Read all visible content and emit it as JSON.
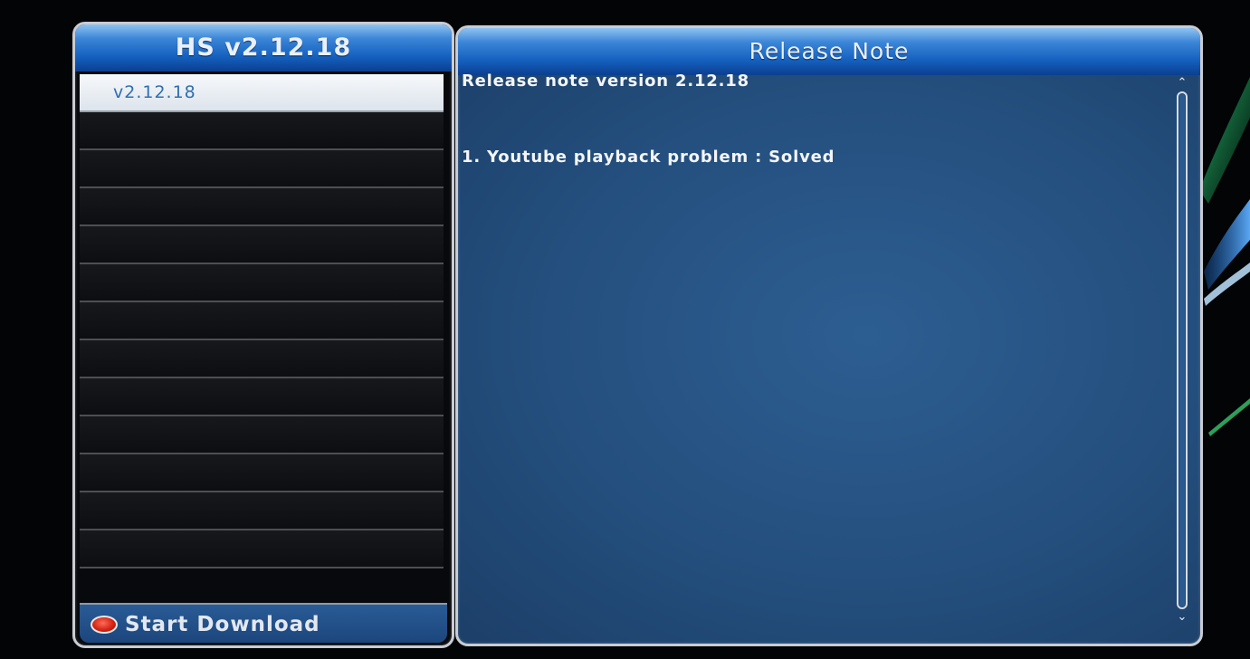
{
  "left_panel": {
    "title": "HS v2.12.18",
    "versions": [
      {
        "label": "v2.12.18",
        "selected": true
      },
      {
        "label": "",
        "selected": false
      },
      {
        "label": "",
        "selected": false
      },
      {
        "label": "",
        "selected": false
      },
      {
        "label": "",
        "selected": false
      },
      {
        "label": "",
        "selected": false
      },
      {
        "label": "",
        "selected": false
      },
      {
        "label": "",
        "selected": false
      },
      {
        "label": "",
        "selected": false
      },
      {
        "label": "",
        "selected": false
      },
      {
        "label": "",
        "selected": false
      },
      {
        "label": "",
        "selected": false
      },
      {
        "label": "",
        "selected": false
      }
    ],
    "footer": {
      "label": "Start Download",
      "icon": "red-button-icon"
    }
  },
  "right_panel": {
    "title": "Release Note",
    "lines": [
      "Release note version 2.12.18",
      "1. Youtube playback problem : Solved"
    ]
  },
  "colors": {
    "header_blue": "#145fbd",
    "panel_bg": "#244f7e",
    "list_bg": "#0d0e11",
    "selected_bg": "#f6f8fb",
    "accent_red": "#d52413"
  }
}
